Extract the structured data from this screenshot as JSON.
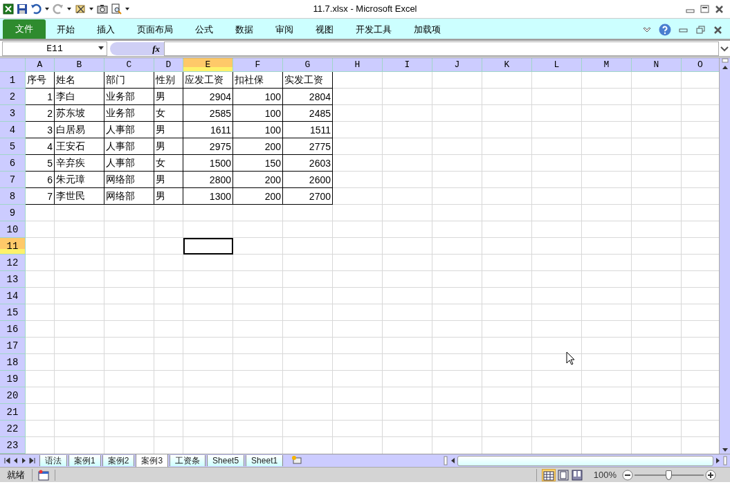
{
  "window": {
    "title": "11.7.xlsx  -  Microsoft Excel"
  },
  "ribbon": {
    "tabs": [
      {
        "label": "文件",
        "kind": "file",
        "selected": false
      },
      {
        "label": "开始",
        "kind": "tab",
        "selected": false
      },
      {
        "label": "插入",
        "kind": "tab",
        "selected": false
      },
      {
        "label": "页面布局",
        "kind": "tab",
        "selected": false
      },
      {
        "label": "公式",
        "kind": "tab",
        "selected": false
      },
      {
        "label": "数据",
        "kind": "tab",
        "selected": false
      },
      {
        "label": "审阅",
        "kind": "tab",
        "selected": false
      },
      {
        "label": "视图",
        "kind": "tab",
        "selected": false
      },
      {
        "label": "开发工具",
        "kind": "tab",
        "selected": false
      },
      {
        "label": "加载项",
        "kind": "tab",
        "selected": false
      }
    ]
  },
  "formula_bar": {
    "name_box": "E11",
    "function_button": "fx"
  },
  "sheet": {
    "columns": [
      {
        "label": "A",
        "selected": false
      },
      {
        "label": "B",
        "selected": false
      },
      {
        "label": "C",
        "selected": false
      },
      {
        "label": "D",
        "selected": false
      },
      {
        "label": "E",
        "selected": true
      },
      {
        "label": "F",
        "selected": false
      },
      {
        "label": "G",
        "selected": false
      },
      {
        "label": "H",
        "selected": false
      },
      {
        "label": "I",
        "selected": false
      },
      {
        "label": "J",
        "selected": false
      },
      {
        "label": "K",
        "selected": false
      },
      {
        "label": "L",
        "selected": false
      },
      {
        "label": "M",
        "selected": false
      },
      {
        "label": "N",
        "selected": false
      },
      {
        "label": "O",
        "selected": false
      }
    ],
    "rows": [
      {
        "number": "1",
        "selected": false,
        "kind": "header",
        "cells": [
          "序号",
          "姓名",
          "部门",
          "性别",
          "应发工资",
          "扣社保",
          "实发工资"
        ]
      },
      {
        "number": "2",
        "selected": false,
        "kind": "record",
        "cells": [
          "1",
          "李白",
          "业务部",
          "男",
          "2904",
          "100",
          "2804"
        ]
      },
      {
        "number": "3",
        "selected": false,
        "kind": "record",
        "cells": [
          "2",
          "苏东坡",
          "业务部",
          "女",
          "2585",
          "100",
          "2485"
        ]
      },
      {
        "number": "4",
        "selected": false,
        "kind": "record",
        "cells": [
          "3",
          "白居易",
          "人事部",
          "男",
          "1611",
          "100",
          "1511"
        ]
      },
      {
        "number": "5",
        "selected": false,
        "kind": "record",
        "cells": [
          "4",
          "王安石",
          "人事部",
          "男",
          "2975",
          "200",
          "2775"
        ]
      },
      {
        "number": "6",
        "selected": false,
        "kind": "record",
        "cells": [
          "5",
          "辛弃疾",
          "人事部",
          "女",
          "1500",
          "150",
          "2603"
        ]
      },
      {
        "number": "7",
        "selected": false,
        "kind": "record",
        "cells": [
          "6",
          "朱元璋",
          "网络部",
          "男",
          "2800",
          "200",
          "2600"
        ]
      },
      {
        "number": "8",
        "selected": false,
        "kind": "record",
        "cells": [
          "7",
          "李世民",
          "网络部",
          "男",
          "1300",
          "200",
          "2700"
        ]
      },
      {
        "number": "9",
        "selected": false,
        "kind": "empty"
      },
      {
        "number": "10",
        "selected": false,
        "kind": "empty"
      },
      {
        "number": "11",
        "selected": true,
        "kind": "empty"
      },
      {
        "number": "12",
        "selected": false,
        "kind": "empty"
      },
      {
        "number": "13",
        "selected": false,
        "kind": "empty"
      },
      {
        "number": "14",
        "selected": false,
        "kind": "empty"
      },
      {
        "number": "15",
        "selected": false,
        "kind": "empty"
      },
      {
        "number": "16",
        "selected": false,
        "kind": "empty"
      },
      {
        "number": "17",
        "selected": false,
        "kind": "empty"
      },
      {
        "number": "18",
        "selected": false,
        "kind": "empty"
      },
      {
        "number": "19",
        "selected": false,
        "kind": "empty"
      },
      {
        "number": "20",
        "selected": false,
        "kind": "empty"
      },
      {
        "number": "21",
        "selected": false,
        "kind": "empty"
      },
      {
        "number": "22",
        "selected": false,
        "kind": "empty"
      },
      {
        "number": "23",
        "selected": false,
        "kind": "empty"
      }
    ]
  },
  "sheet_tabs": [
    {
      "label": "语法",
      "selected": false
    },
    {
      "label": "案例1",
      "selected": false
    },
    {
      "label": "案例2",
      "selected": false
    },
    {
      "label": "案例3",
      "selected": true
    },
    {
      "label": "工资条",
      "selected": false
    },
    {
      "label": "Sheet5",
      "selected": false
    },
    {
      "label": "Sheet1",
      "selected": false
    }
  ],
  "status_bar": {
    "status": "就绪",
    "views": [
      {
        "kind": "normal",
        "selected": true
      },
      {
        "kind": "layout",
        "selected": false
      },
      {
        "kind": "pagebreak",
        "selected": false
      }
    ],
    "zoom": "100%",
    "zoom_slider": {
      "level": 0.5
    }
  }
}
